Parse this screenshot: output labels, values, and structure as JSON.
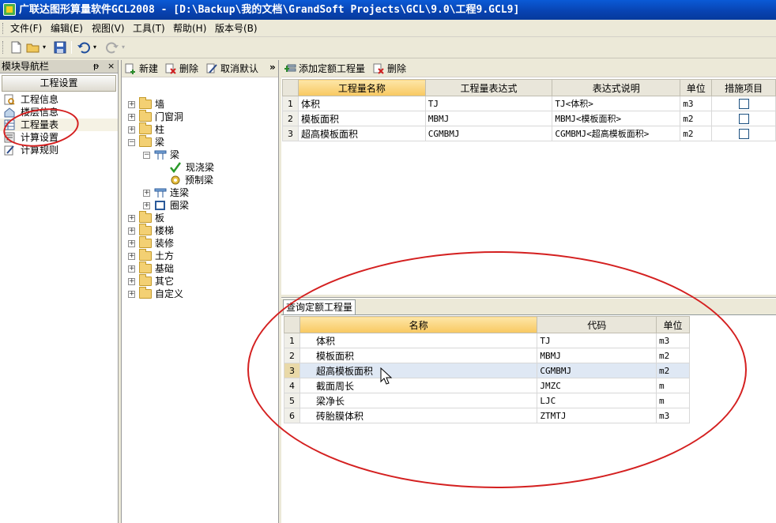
{
  "window": {
    "title": "广联达图形算量软件GCL2008 - [D:\\Backup\\我的文档\\GrandSoft Projects\\GCL\\9.0\\工程9.GCL9]"
  },
  "menu": [
    {
      "label": "文件(F)"
    },
    {
      "label": "编辑(E)"
    },
    {
      "label": "视图(V)"
    },
    {
      "label": "工具(T)"
    },
    {
      "label": "帮助(H)"
    },
    {
      "label": "版本号(B)"
    }
  ],
  "toolbar": {
    "icons": [
      "new-file-icon",
      "open-folder-icon",
      "save-icon",
      "undo-icon",
      "redo-icon"
    ]
  },
  "nav": {
    "title": "模块导航栏",
    "pin": "ᵽ",
    "close": "×",
    "group": "工程设置",
    "items": [
      {
        "label": "工程信息",
        "icon": "info-icon"
      },
      {
        "label": "楼层信息",
        "icon": "floor-icon"
      },
      {
        "label": "工程量表",
        "icon": "table-icon"
      },
      {
        "label": "计算设置",
        "icon": "settings-icon"
      },
      {
        "label": "计算规则",
        "icon": "rule-icon"
      }
    ]
  },
  "tree_toolbar": {
    "new": "新建",
    "delete": "删除",
    "cancel_default": "取消默认",
    "more": "»"
  },
  "tree": [
    {
      "label": "墙",
      "level": 0,
      "expander": "+",
      "icon": "folder"
    },
    {
      "label": "门窗洞",
      "level": 0,
      "expander": "+",
      "icon": "folder"
    },
    {
      "label": "柱",
      "level": 0,
      "expander": "+",
      "icon": "folder"
    },
    {
      "label": "梁",
      "level": 0,
      "expander": "−",
      "icon": "folder-open"
    },
    {
      "label": "梁",
      "level": 1,
      "expander": "−",
      "icon": "beam"
    },
    {
      "label": "现浇梁",
      "level": 2,
      "expander": "",
      "icon": "check",
      "selected": true
    },
    {
      "label": "预制梁",
      "level": 2,
      "expander": "",
      "icon": "gear"
    },
    {
      "label": "连梁",
      "level": 1,
      "expander": "+",
      "icon": "beam"
    },
    {
      "label": "圈梁",
      "level": 1,
      "expander": "+",
      "icon": "ring-beam"
    },
    {
      "label": "板",
      "level": 0,
      "expander": "+",
      "icon": "folder"
    },
    {
      "label": "楼梯",
      "level": 0,
      "expander": "+",
      "icon": "folder"
    },
    {
      "label": "装修",
      "level": 0,
      "expander": "+",
      "icon": "folder"
    },
    {
      "label": "土方",
      "level": 0,
      "expander": "+",
      "icon": "folder"
    },
    {
      "label": "基础",
      "level": 0,
      "expander": "+",
      "icon": "folder"
    },
    {
      "label": "其它",
      "level": 0,
      "expander": "+",
      "icon": "folder"
    },
    {
      "label": "自定义",
      "level": 0,
      "expander": "+",
      "icon": "folder"
    }
  ],
  "qty_toolbar": {
    "add": "添加定额工程量",
    "delete": "删除"
  },
  "qty_table": {
    "headers": [
      "工程量名称",
      "工程量表达式",
      "表达式说明",
      "单位",
      "措施项目"
    ],
    "rows": [
      {
        "n": "1",
        "name": "体积",
        "expr": "TJ",
        "desc": "TJ<体积>",
        "unit": "m3",
        "measure": false
      },
      {
        "n": "2",
        "name": "模板面积",
        "expr": "MBMJ",
        "desc": "MBMJ<模板面积>",
        "unit": "m2",
        "measure": false
      },
      {
        "n": "3",
        "name": "超高模板面积",
        "expr": "CGMBMJ",
        "desc": "CGMBMJ<超高模板面积>",
        "unit": "m2",
        "measure": false
      }
    ]
  },
  "query": {
    "tab": "查询定额工程量",
    "headers": [
      "名称",
      "代码",
      "单位"
    ],
    "rows": [
      {
        "n": "1",
        "name": "体积",
        "code": "TJ",
        "unit": "m3"
      },
      {
        "n": "2",
        "name": "模板面积",
        "code": "MBMJ",
        "unit": "m2"
      },
      {
        "n": "3",
        "name": "超高模板面积",
        "code": "CGMBMJ",
        "unit": "m2",
        "highlighted": true
      },
      {
        "n": "4",
        "name": "截面周长",
        "code": "JMZC",
        "unit": "m"
      },
      {
        "n": "5",
        "name": "梁净长",
        "code": "LJC",
        "unit": "m"
      },
      {
        "n": "6",
        "name": "砖胎膜体积",
        "code": "ZTMTJ",
        "unit": "m3"
      }
    ]
  },
  "colors": {
    "annotation": "#d42020",
    "title_bar": "#0a5ad6",
    "header_selected": "#f8c860"
  }
}
